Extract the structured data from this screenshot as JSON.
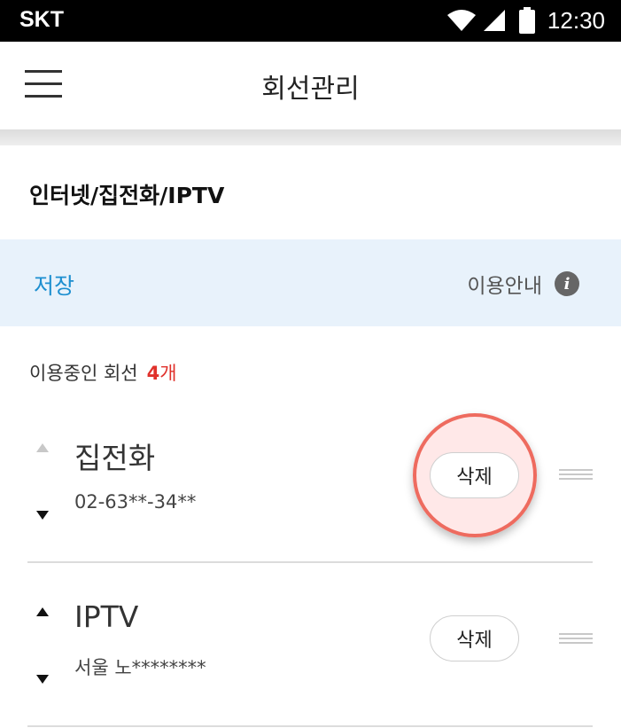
{
  "status_bar": {
    "carrier": "SKT",
    "time": "12:30",
    "icons": [
      "wifi-icon",
      "signal-icon",
      "battery-icon"
    ]
  },
  "app_bar": {
    "menu_icon": "hamburger-menu-icon",
    "title": "회선관리"
  },
  "section": {
    "title": "인터넷/집전화/IPTV"
  },
  "actions": {
    "save_label": "저장",
    "guide_label": "이용안내",
    "guide_icon": "info-icon"
  },
  "summary": {
    "label": "이용중인 회선",
    "count": "4",
    "unit": "개"
  },
  "lines": [
    {
      "name": "집전화",
      "number": "02-63**-34**",
      "delete_label": "삭제",
      "up_enabled": false,
      "down_enabled": true,
      "highlighted": true
    },
    {
      "name": "IPTV",
      "number": "서울 노********",
      "delete_label": "삭제",
      "up_enabled": true,
      "down_enabled": true,
      "highlighted": false
    }
  ],
  "colors": {
    "accent_blue": "#1d8fd0",
    "count_red": "#e0312b",
    "action_bar_bg": "#e8f2fb",
    "highlight_ring": "#ee6b5f"
  }
}
